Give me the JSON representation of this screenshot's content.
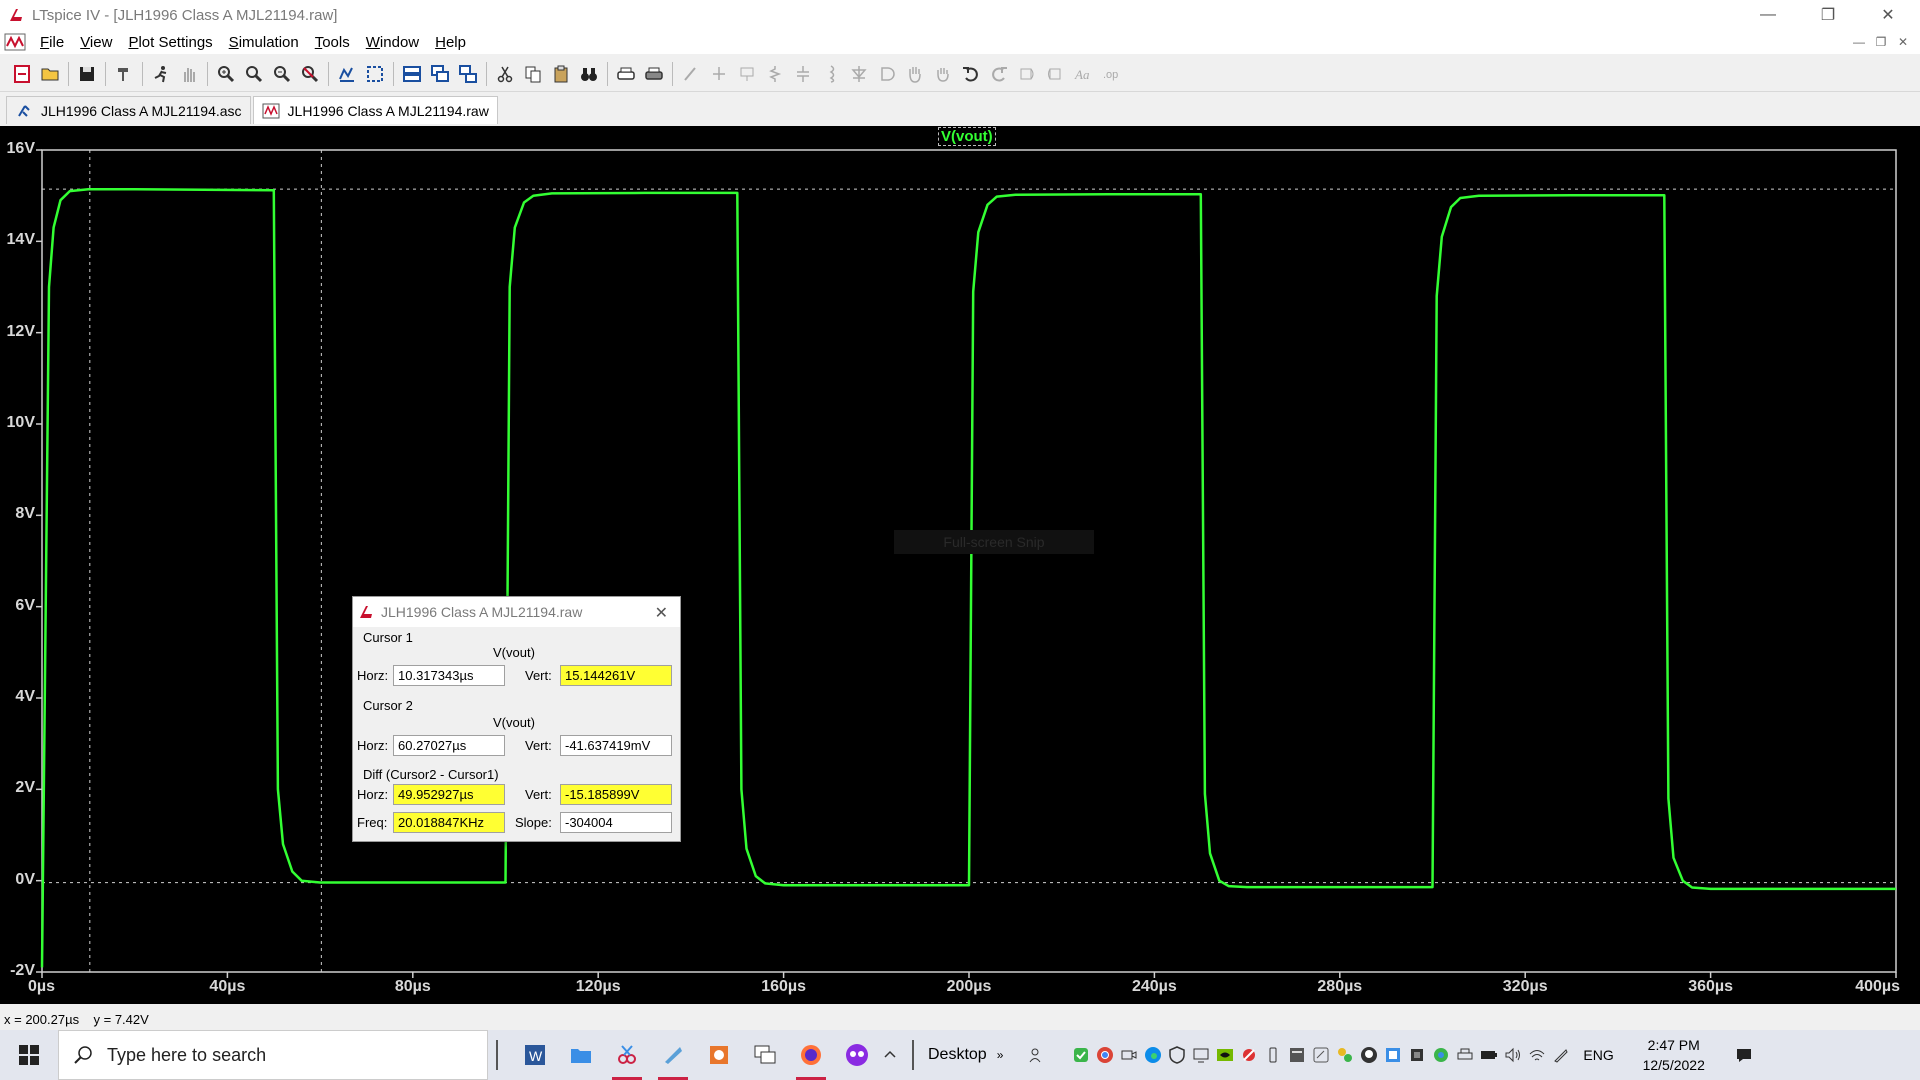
{
  "window": {
    "title": "LTspice IV - [JLH1996 Class A MJL21194.raw]",
    "controls": [
      "—",
      "❐",
      "✕"
    ]
  },
  "menu": {
    "items": [
      "File",
      "View",
      "Plot Settings",
      "Simulation",
      "Tools",
      "Window",
      "Help"
    ]
  },
  "tabs": [
    {
      "label": "JLH1996 Class A MJL21194.asc",
      "active": false
    },
    {
      "label": "JLH1996 Class A MJL21194.raw",
      "active": true
    }
  ],
  "plot": {
    "trace_name": "V(vout)",
    "snip_overlay": "Full-screen Snip",
    "colors": {
      "background": "#000000",
      "trace": "#33ff33",
      "grid": "#cfcfcf"
    }
  },
  "chart_data": {
    "type": "line",
    "series": [
      {
        "name": "V(vout)",
        "x": [
          0,
          1.5,
          2.5,
          4,
          6,
          10,
          20,
          50.0,
          50.9,
          52,
          54,
          56,
          60,
          80,
          100.0,
          100.9,
          102,
          104,
          106,
          110,
          130,
          150.0,
          150.9,
          152,
          154,
          156,
          160,
          180,
          200.0,
          200.9,
          202,
          204,
          206,
          210,
          230,
          250.0,
          250.9,
          252,
          254,
          256,
          260,
          280,
          300.0,
          300.9,
          302,
          304,
          306,
          310,
          330,
          350.0,
          350.9,
          352,
          354,
          356,
          360,
          380,
          400
        ],
        "y": [
          -1.9,
          13.0,
          14.3,
          14.9,
          15.1,
          15.14,
          15.14,
          15.12,
          2.0,
          0.8,
          0.2,
          0.0,
          -0.04,
          -0.04,
          -0.04,
          13.0,
          14.3,
          14.85,
          15.0,
          15.05,
          15.06,
          15.06,
          2.0,
          0.7,
          0.1,
          -0.06,
          -0.1,
          -0.1,
          -0.1,
          12.9,
          14.2,
          14.8,
          14.98,
          15.02,
          15.03,
          15.03,
          1.9,
          0.6,
          0.0,
          -0.12,
          -0.14,
          -0.14,
          -0.14,
          12.8,
          14.1,
          14.75,
          14.95,
          15.0,
          15.01,
          15.01,
          1.8,
          0.5,
          0.0,
          -0.15,
          -0.18,
          -0.18,
          -0.18
        ]
      }
    ],
    "xlim": [
      0,
      400
    ],
    "ylim": [
      -2,
      16
    ],
    "x_ticks": [
      "0µs",
      "40µs",
      "80µs",
      "120µs",
      "160µs",
      "200µs",
      "240µs",
      "280µs",
      "320µs",
      "360µs",
      "400µs"
    ],
    "y_ticks": [
      "-2V",
      "0V",
      "2V",
      "4V",
      "6V",
      "8V",
      "10V",
      "12V",
      "14V",
      "16V"
    ],
    "x_tick_values": [
      0,
      40,
      80,
      120,
      160,
      200,
      240,
      280,
      320,
      360,
      400
    ],
    "y_tick_values": [
      -2,
      0,
      2,
      4,
      6,
      8,
      10,
      12,
      14,
      16
    ],
    "cursors": {
      "cursor1_x": 10.317343,
      "cursor1_y": 15.144261,
      "cursor2_x": 60.27027,
      "cursor2_y": -0.041637
    }
  },
  "dialog": {
    "title": "JLH1996 Class A MJL21194.raw",
    "cursor1": {
      "group": "Cursor 1",
      "trace": "V(vout)",
      "horz_label": "Horz:",
      "horz": "10.317343µs",
      "vert_label": "Vert:",
      "vert": "15.144261V"
    },
    "cursor2": {
      "group": "Cursor 2",
      "trace": "V(vout)",
      "horz_label": "Horz:",
      "horz": "60.27027µs",
      "vert_label": "Vert:",
      "vert": "-41.637419mV"
    },
    "diff": {
      "group": "Diff (Cursor2 - Cursor1)",
      "horz_label": "Horz:",
      "horz": "49.952927µs",
      "vert_label": "Vert:",
      "vert": "-15.185899V",
      "freq_label": "Freq:",
      "freq": "20.018847KHz",
      "slope_label": "Slope:",
      "slope": "-304004"
    },
    "highlight_color": "#ffff33"
  },
  "status": {
    "text": "x = 200.27µs    y = 7.42V"
  },
  "taskbar": {
    "search_placeholder": "Type here to search",
    "desktop_label": "Desktop",
    "language": "ENG",
    "time": "2:47 PM",
    "date": "12/5/2022"
  }
}
